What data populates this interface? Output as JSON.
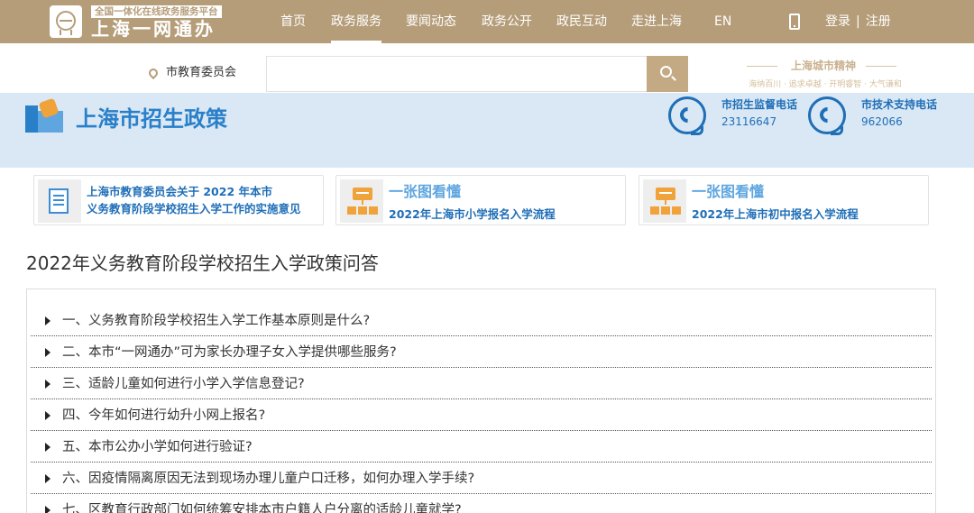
{
  "header": {
    "logo_subtitle": "全国一体化在线政务服务平台",
    "logo_title": "上海一网通办",
    "nav": [
      "首页",
      "政务服务",
      "要闻动态",
      "政务公开",
      "政民互动",
      "走进上海",
      "EN"
    ],
    "active_nav": "政务服务",
    "login": "登录",
    "register": "注册"
  },
  "search": {
    "region": "市教育委员会",
    "placeholder": "",
    "slogan_title": "上海城市精神",
    "slogan_sub": "海纳百川 · 追求卓越 · 开明睿智 · 大气谦和"
  },
  "banner": {
    "title": "上海市招生政策",
    "hotlines": [
      {
        "label": "市招生监督电话",
        "number": "23116647"
      },
      {
        "label": "市技术支持电话",
        "number": "962066"
      }
    ]
  },
  "cards": [
    {
      "line1": "上海市教育委员会关于 2022 年本市",
      "line2": "义务教育阶段学校招生入学工作的实施意见"
    },
    {
      "big": "一张图看懂",
      "small": "2022年上海市小学报名入学流程"
    },
    {
      "big": "一张图看懂",
      "small": "2022年上海市初中报名入学流程"
    }
  ],
  "section_title": "2022年义务教育阶段学校招生入学政策问答",
  "faq": [
    "一、义务教育阶段学校招生入学工作基本原则是什么?",
    "二、本市“一网通办”可为家长办理子女入学提供哪些服务?",
    "三、适龄儿童如何进行小学入学信息登记?",
    "四、今年如何进行幼升小网上报名?",
    "五、本市公办小学如何进行验证?",
    "六、因疫情隔离原因无法到现场办理儿童户口迁移，如何办理入学手续?",
    "七、区教育行政部门如何统筹安排本市户籍人户分离的适龄儿童就学?"
  ]
}
